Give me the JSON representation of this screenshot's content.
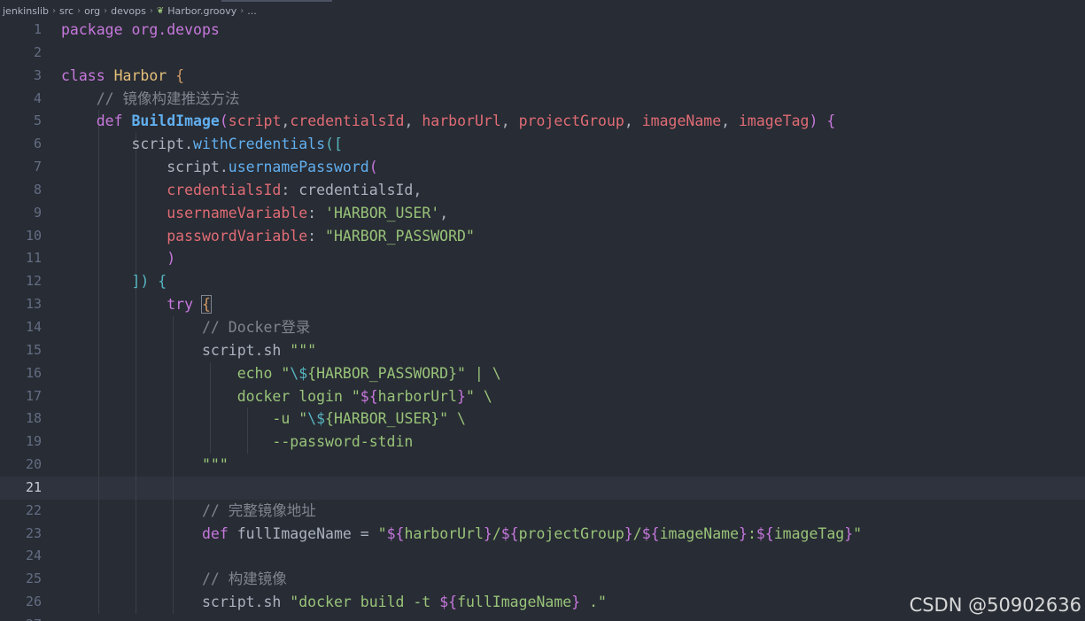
{
  "breadcrumb": {
    "items": [
      "jenkinslib",
      "src",
      "org",
      "devops"
    ],
    "file_icon": "groovy-icon",
    "file": "Harbor.groovy",
    "more": "..."
  },
  "editor": {
    "current_line": 21,
    "colors": {
      "background": "#282c34",
      "keyword": "#c678dd",
      "class": "#e5c07b",
      "function": "#61afef",
      "parameter": "#e06c75",
      "string": "#98c379",
      "comment": "#7f848e"
    },
    "lines": [
      [
        {
          "t": "kw",
          "v": "package"
        },
        {
          "t": "",
          "v": " "
        },
        {
          "t": "kw",
          "v": "org.devops"
        }
      ],
      [],
      [
        {
          "t": "kw",
          "v": "class"
        },
        {
          "t": "",
          "v": " "
        },
        {
          "t": "cls",
          "v": "Harbor"
        },
        {
          "t": "",
          "v": " "
        },
        {
          "t": "br1",
          "v": "{"
        }
      ],
      [
        {
          "t": "",
          "v": "    "
        },
        {
          "t": "cmt",
          "v": "// 镜像构建推送方法"
        }
      ],
      [
        {
          "t": "",
          "v": "    "
        },
        {
          "t": "kw",
          "v": "def"
        },
        {
          "t": "",
          "v": " "
        },
        {
          "t": "fn",
          "v": "BuildImage"
        },
        {
          "t": "br2",
          "v": "("
        },
        {
          "t": "param",
          "v": "script"
        },
        {
          "t": "",
          "v": ","
        },
        {
          "t": "param",
          "v": "credentialsId"
        },
        {
          "t": "",
          "v": ", "
        },
        {
          "t": "param",
          "v": "harborUrl"
        },
        {
          "t": "",
          "v": ", "
        },
        {
          "t": "param",
          "v": "projectGroup"
        },
        {
          "t": "",
          "v": ", "
        },
        {
          "t": "param",
          "v": "imageName"
        },
        {
          "t": "",
          "v": ", "
        },
        {
          "t": "param",
          "v": "imageTag"
        },
        {
          "t": "br2",
          "v": ")"
        },
        {
          "t": "",
          "v": " "
        },
        {
          "t": "br2",
          "v": "{"
        }
      ],
      [
        {
          "t": "",
          "v": "        "
        },
        {
          "t": "",
          "v": "script."
        },
        {
          "t": "mth",
          "v": "withCredentials"
        },
        {
          "t": "br3",
          "v": "(["
        }
      ],
      [
        {
          "t": "",
          "v": "            "
        },
        {
          "t": "",
          "v": "script."
        },
        {
          "t": "mth",
          "v": "usernamePassword"
        },
        {
          "t": "br2",
          "v": "("
        }
      ],
      [
        {
          "t": "",
          "v": "            "
        },
        {
          "t": "param",
          "v": "credentialsId"
        },
        {
          "t": "",
          "v": ": credentialsId,"
        }
      ],
      [
        {
          "t": "",
          "v": "            "
        },
        {
          "t": "param",
          "v": "usernameVariable"
        },
        {
          "t": "",
          "v": ": "
        },
        {
          "t": "str",
          "v": "'HARBOR_USER'"
        },
        {
          "t": "",
          "v": ","
        }
      ],
      [
        {
          "t": "",
          "v": "            "
        },
        {
          "t": "param",
          "v": "passwordVariable"
        },
        {
          "t": "",
          "v": ": "
        },
        {
          "t": "str",
          "v": "\"HARBOR_PASSWORD\""
        }
      ],
      [
        {
          "t": "",
          "v": "            "
        },
        {
          "t": "br2",
          "v": ")"
        }
      ],
      [
        {
          "t": "",
          "v": "        "
        },
        {
          "t": "br3",
          "v": "])"
        },
        {
          "t": "",
          "v": " "
        },
        {
          "t": "br3",
          "v": "{"
        }
      ],
      [
        {
          "t": "",
          "v": "            "
        },
        {
          "t": "kw",
          "v": "try"
        },
        {
          "t": "",
          "v": " "
        },
        {
          "t": "br1 bracket-box",
          "v": "{"
        }
      ],
      [
        {
          "t": "",
          "v": "                "
        },
        {
          "t": "cmt",
          "v": "// Docker登录"
        }
      ],
      [
        {
          "t": "",
          "v": "                "
        },
        {
          "t": "",
          "v": "script.sh "
        },
        {
          "t": "str",
          "v": "\"\"\""
        }
      ],
      [
        {
          "t": "",
          "v": "                    "
        },
        {
          "t": "str",
          "v": "echo \""
        },
        {
          "t": "esc",
          "v": "\\$"
        },
        {
          "t": "str",
          "v": "{HARBOR_PASSWORD}\" | \\"
        }
      ],
      [
        {
          "t": "",
          "v": "                    "
        },
        {
          "t": "str",
          "v": "docker login \""
        },
        {
          "t": "kw",
          "v": "${"
        },
        {
          "t": "str",
          "v": "harborUrl"
        },
        {
          "t": "kw",
          "v": "}"
        },
        {
          "t": "str",
          "v": "\" \\"
        }
      ],
      [
        {
          "t": "",
          "v": "                        "
        },
        {
          "t": "str",
          "v": "-u \""
        },
        {
          "t": "esc",
          "v": "\\$"
        },
        {
          "t": "str",
          "v": "{HARBOR_USER}\" \\"
        }
      ],
      [
        {
          "t": "",
          "v": "                        "
        },
        {
          "t": "str",
          "v": "--password-stdin"
        }
      ],
      [
        {
          "t": "",
          "v": "                "
        },
        {
          "t": "str",
          "v": "\"\"\""
        }
      ],
      [],
      [
        {
          "t": "",
          "v": "                "
        },
        {
          "t": "cmt",
          "v": "// 完整镜像地址"
        }
      ],
      [
        {
          "t": "",
          "v": "                "
        },
        {
          "t": "kw",
          "v": "def"
        },
        {
          "t": "",
          "v": " fullImageName = "
        },
        {
          "t": "str",
          "v": "\""
        },
        {
          "t": "kw",
          "v": "${"
        },
        {
          "t": "str",
          "v": "harborUrl"
        },
        {
          "t": "kw",
          "v": "}"
        },
        {
          "t": "str",
          "v": "/"
        },
        {
          "t": "kw",
          "v": "${"
        },
        {
          "t": "str",
          "v": "projectGroup"
        },
        {
          "t": "kw",
          "v": "}"
        },
        {
          "t": "str",
          "v": "/"
        },
        {
          "t": "kw",
          "v": "${"
        },
        {
          "t": "str",
          "v": "imageName"
        },
        {
          "t": "kw",
          "v": "}"
        },
        {
          "t": "str",
          "v": ":"
        },
        {
          "t": "kw",
          "v": "${"
        },
        {
          "t": "str",
          "v": "imageTag"
        },
        {
          "t": "kw",
          "v": "}"
        },
        {
          "t": "str",
          "v": "\""
        }
      ],
      [],
      [
        {
          "t": "",
          "v": "                "
        },
        {
          "t": "cmt",
          "v": "// 构建镜像"
        }
      ],
      [
        {
          "t": "",
          "v": "                "
        },
        {
          "t": "",
          "v": "script.sh "
        },
        {
          "t": "str",
          "v": "\"docker build -t "
        },
        {
          "t": "kw",
          "v": "${"
        },
        {
          "t": "str",
          "v": "fullImageName"
        },
        {
          "t": "kw",
          "v": "}"
        },
        {
          "t": "str",
          "v": " .\""
        }
      ],
      []
    ]
  },
  "watermark": "CSDN @50902636"
}
